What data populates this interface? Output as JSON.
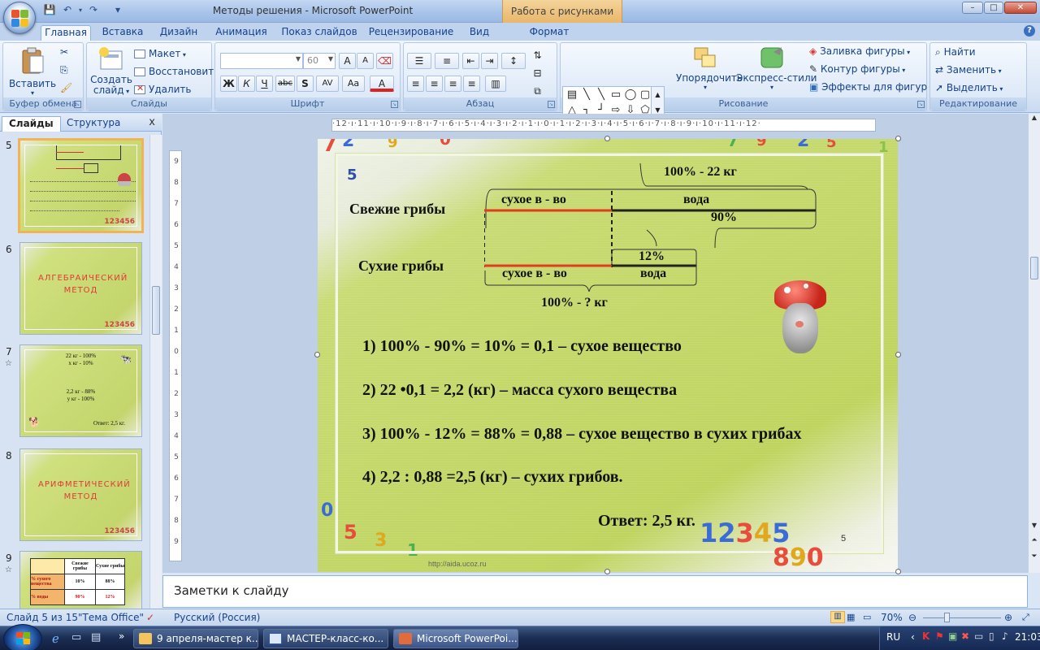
{
  "window": {
    "title": "Методы решения - Microsoft PowerPoint",
    "context_tools": "Работа с рисунками",
    "min": "–",
    "max": "□",
    "close": "✕"
  },
  "qat": {
    "save": "💾",
    "undo": "↶",
    "redo": "↷",
    "more": "▾"
  },
  "tabs": [
    {
      "label": "Главная"
    },
    {
      "label": "Вставка"
    },
    {
      "label": "Дизайн"
    },
    {
      "label": "Анимация"
    },
    {
      "label": "Показ слайдов"
    },
    {
      "label": "Рецензирование"
    },
    {
      "label": "Вид"
    },
    {
      "label": "Формат"
    }
  ],
  "help": "?",
  "ribbon": {
    "clipboard": {
      "label": "Буфер обмена",
      "paste": "Вставить"
    },
    "slides": {
      "label": "Слайды",
      "new_slide_1": "Создать",
      "new_slide_2": "слайд",
      "layout": "Макет",
      "reset": "Восстановить",
      "delete": "Удалить"
    },
    "font": {
      "label": "Шрифт",
      "font_name": "",
      "font_size": "60",
      "bold": "Ж",
      "italic": "К",
      "underline": "Ч",
      "strike": "abc",
      "shadow": "S",
      "spacing": "AV",
      "case": "Aa",
      "color": "A",
      "grow": "A",
      "shrink": "A"
    },
    "paragraph": {
      "label": "Абзац"
    },
    "drawing": {
      "label": "Рисование",
      "arrange": "Упорядочить",
      "quick_styles": "Экспресс-стили",
      "fill": "Заливка фигуры",
      "outline": "Контур фигуры",
      "effects": "Эффекты для фигур"
    },
    "editing": {
      "label": "Редактирование",
      "find": "Найти",
      "replace": "Заменить",
      "select": "Выделить"
    }
  },
  "pane": {
    "tab_slides": "Слайды",
    "tab_outline": "Структура",
    "close": "x",
    "thumbs": [
      {
        "num": "5",
        "title": ""
      },
      {
        "num": "6",
        "title": "АЛГЕБРАИЧЕСКИЙ МЕТОД"
      },
      {
        "num": "7",
        "title": ""
      },
      {
        "num": "8",
        "title": "АРИФМЕТИЧЕСКИЙ МЕТОД"
      },
      {
        "num": "9",
        "title": ""
      }
    ],
    "thumb7": {
      "l1": "22 кг - 100%",
      "l2": "x кг - 10%",
      "l5": "2,2 кг - 88%",
      "l6": "y кг - 100%",
      "answer": "Ответ: 2,5 кг."
    },
    "thumb9": {
      "h1": "Свежие грибы",
      "h2": "Сухие грибы",
      "r1": "% сухого вещества",
      "r1a": "10%",
      "r1b": "88%",
      "r2": "% воды",
      "r2a": "90%",
      "r2b": "12%"
    },
    "thumbnums": "123456"
  },
  "ruler_h": "·12·ı·11·ı·10·ı·9·ı·8·ı·7·ı·6·ı·5·ı·4·ı·3·ı·2·ı·1·ı·0·ı·1·ı·2·ı·3·ı·4·ı·5·ı·6·ı·7·ı·8·ı·9·ı·10·ı·11·ı·12·",
  "ruler_v": [
    "9",
    "8",
    "7",
    "6",
    "5",
    "4",
    "3",
    "2",
    "1",
    "0",
    "1",
    "2",
    "3",
    "4",
    "5",
    "6",
    "7",
    "8",
    "9"
  ],
  "slide": {
    "top_total": "100% - 22 кг",
    "fresh_label": "Свежие грибы",
    "dry_matter_top": "сухое в - во",
    "water_top": "вода",
    "water_pct": "90%",
    "dry_label": "Сухие грибы",
    "water_pct2": "12%",
    "dry_matter_bottom": "сухое в - во",
    "water_bottom": "вода",
    "bottom_total": "100% - ? кг",
    "step1": "1) 100% - 90% = 10% = 0,1 – сухое вещество",
    "step2": "2) 22 •0,1 = 2,2 (кг) – масса сухого вещества",
    "step3": "3) 100% - 12% = 88% = 0,88 – сухое вещество в сухих грибах",
    "step4": "4)  2,2 : 0,88 =2,5 (кг) – сухих грибов.",
    "answer": "Ответ: 2,5 кг.",
    "page_num": "5",
    "url": "http://aida.ucoz.ru",
    "bottom_digits": "123456789"
  },
  "notes": "Заметки к слайду",
  "status": {
    "slide": "Слайд 5 из 15",
    "theme": "\"Тема Office\"",
    "lang": "Русский (Россия)",
    "zoom": "70%"
  },
  "taskbar": {
    "items": [
      {
        "label": "9 апреля-мастер к..."
      },
      {
        "label": "МАСТЕР-класс-ко..."
      },
      {
        "label": "Microsoft PowerPoi..."
      }
    ],
    "lang": "RU",
    "time": "21:03"
  }
}
